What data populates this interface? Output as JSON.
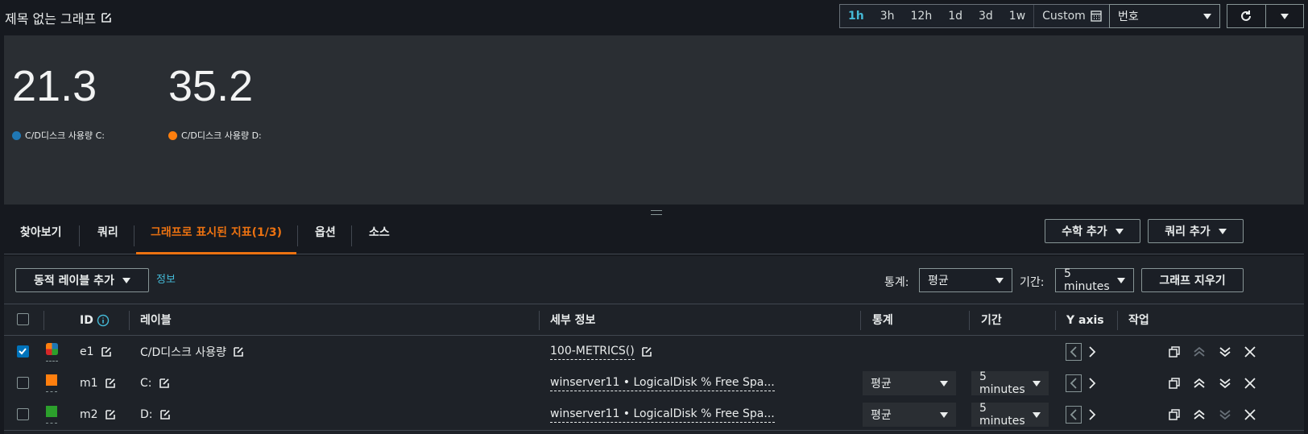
{
  "header": {
    "title": "제목 없는 그래프",
    "time_ranges": [
      "1h",
      "3h",
      "12h",
      "1d",
      "3d",
      "1w"
    ],
    "active_range": "1h",
    "custom_label": "Custom",
    "view_select": "번호"
  },
  "graph": {
    "stats": [
      {
        "value": "21.3",
        "label": "C/D디스크 사용량 C:",
        "color": "#1f77b4"
      },
      {
        "value": "35.2",
        "label": "C/D디스크 사용량 D:",
        "color": "#ff7f0e"
      }
    ]
  },
  "tabs": {
    "browse": "찾아보기",
    "query": "쿼리",
    "graphed": "그래프로 표시된 지표(1/3)",
    "options": "옵션",
    "source": "소스",
    "add_math": "수학 추가",
    "add_query": "쿼리 추가"
  },
  "toolbar": {
    "dynamic_label": "동적 레이블 추가",
    "info_link": "정보",
    "stat_label": "통계:",
    "stat_value": "평균",
    "period_label": "기간:",
    "period_value": "5 minutes",
    "clear_graph": "그래프 지우기"
  },
  "table": {
    "headers": {
      "id": "ID",
      "label": "레이블",
      "details": "세부 정보",
      "stat": "통계",
      "period": "기간",
      "yaxis": "Y axis",
      "actions": "작업"
    },
    "rows": [
      {
        "id": "e1",
        "label": "C/D디스크 사용량",
        "details": "100-METRICS()",
        "stat": "",
        "period": "",
        "checked": true
      },
      {
        "id": "m1",
        "label": "C:",
        "details": "winserver11 • LogicalDisk % Free Spa...",
        "stat": "평균",
        "period": "5 minutes",
        "checked": false,
        "color": "#ff7f0e"
      },
      {
        "id": "m2",
        "label": "D:",
        "details": "winserver11 • LogicalDisk % Free Spa...",
        "stat": "평균",
        "period": "5 minutes",
        "checked": false,
        "color": "#2ca02c"
      }
    ]
  },
  "colors": {
    "accent": "#ec7211",
    "link": "#44b9d6",
    "checkbox": "#0073bb"
  }
}
